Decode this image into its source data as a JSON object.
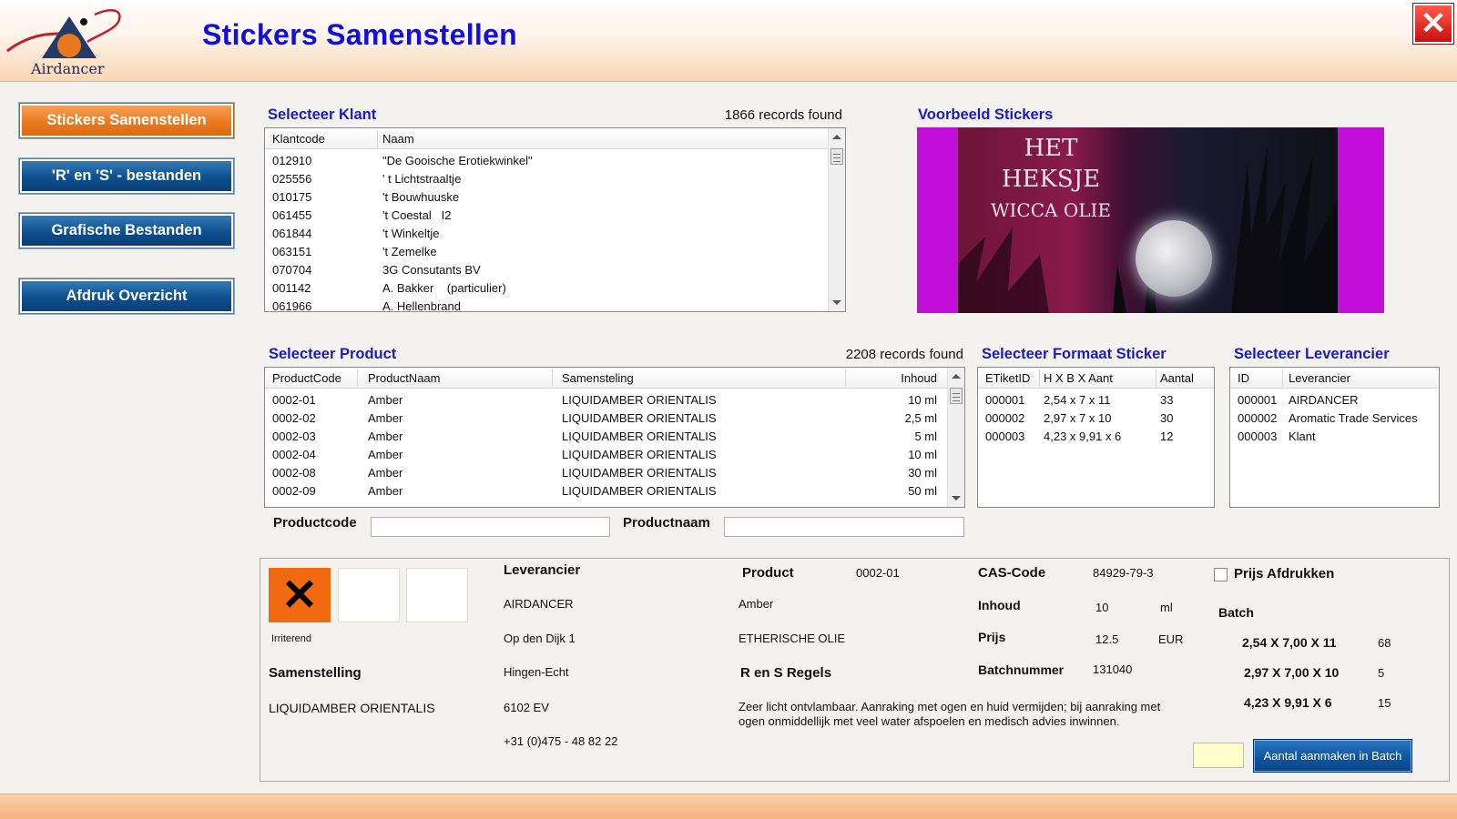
{
  "header": {
    "logo_text": "Airdancer",
    "title": "Stickers Samenstellen",
    "close_label": "✕"
  },
  "nav": {
    "items": [
      {
        "label": "Stickers Samenstellen",
        "active": true
      },
      {
        "label": "'R' en 'S' - bestanden",
        "active": false
      },
      {
        "label": "Grafische Bestanden",
        "active": false
      },
      {
        "label": "Afdruk Overzicht",
        "active": false
      }
    ]
  },
  "klant": {
    "title": "Selecteer Klant",
    "records": "1866 records found",
    "columns": [
      "Klantcode",
      "Naam"
    ],
    "rows": [
      [
        "012910",
        "\"De Gooische Erotiekwinkel\""
      ],
      [
        "025556",
        "' t Lichtstraaltje"
      ],
      [
        "010175",
        "'t Bouwhuuske"
      ],
      [
        "061455",
        "'t Coestal   I2"
      ],
      [
        "061844",
        "'t Winkeltje"
      ],
      [
        "063151",
        "'t Zemelke"
      ],
      [
        "070704",
        "3G Consutants BV"
      ],
      [
        "001142",
        "A. Bakker    (particulier)"
      ],
      [
        "061966",
        "A. Hellenbrand"
      ]
    ]
  },
  "preview": {
    "title": "Voorbeeld Stickers",
    "label_line1": "HET HEKSJE",
    "label_line2": "WICCA OLIE",
    "bg_color": "#c10ed8"
  },
  "product": {
    "title": "Selecteer Product",
    "records": "2208 records found",
    "columns": [
      "ProductCode",
      "ProductNaam",
      "Samensteling",
      "Inhoud"
    ],
    "rows": [
      [
        "0002-01",
        "Amber",
        "LIQUIDAMBER ORIENTALIS",
        "10 ml"
      ],
      [
        "0002-02",
        "Amber",
        "LIQUIDAMBER ORIENTALIS",
        "2,5 ml"
      ],
      [
        "0002-03",
        "Amber",
        "LIQUIDAMBER ORIENTALIS",
        "5 ml"
      ],
      [
        "0002-04",
        "Amber",
        "LIQUIDAMBER ORIENTALIS",
        "10 ml"
      ],
      [
        "0002-08",
        "Amber",
        "LIQUIDAMBER ORIENTALIS",
        "30 ml"
      ],
      [
        "0002-09",
        "Amber",
        "LIQUIDAMBER ORIENTALIS",
        "50 ml"
      ]
    ],
    "productcode_label": "Productcode",
    "productnaam_label": "Productnaam",
    "productcode_value": "",
    "productnaam_value": ""
  },
  "formaat": {
    "title": "Selecteer Formaat Sticker",
    "columns": [
      "ETiketID",
      "H X B X Aant",
      "Aantal"
    ],
    "rows": [
      [
        "000001",
        "2,54 x 7 x 11",
        "33"
      ],
      [
        "000002",
        "2,97 x 7 x 10",
        "30"
      ],
      [
        "000003",
        "4,23 x 9,91 x 6",
        "12"
      ]
    ]
  },
  "leverancier": {
    "title": "Selecteer Leverancier",
    "columns": [
      "ID",
      "Leverancier"
    ],
    "rows": [
      [
        "000001",
        "AIRDANCER"
      ],
      [
        "000002",
        "Aromatic Trade Services"
      ],
      [
        "000003",
        "Klant"
      ]
    ]
  },
  "detail": {
    "hazard_label": "Irriterend",
    "hazard_symbol": "✕",
    "samenstelling_label": "Samenstelling",
    "samenstelling_value": "LIQUIDAMBER ORIENTALIS",
    "leverancier_label": "Leverancier",
    "leverancier_name": "AIRDANCER",
    "leverancier_address": "Op den Dijk 1",
    "leverancier_city": "Hingen-Echt",
    "leverancier_zip": "6102 EV",
    "leverancier_phone": "+31 (0)475 - 48 82 22",
    "product_label": "Product",
    "product_code": "0002-01",
    "product_name": "Amber",
    "product_type": "ETHERISCHE OLIE",
    "rs_label": "R en S Regels",
    "rs_text_line1": "Zeer licht ontvlambaar. Aanraking met ogen en huid vermijden; bij aanraking met",
    "rs_text_line2": "ogen onmiddellijk met veel water afspoelen en medisch advies inwinnen.",
    "cas_label": "CAS-Code",
    "cas_value": "84929-79-3",
    "inhoud_label": "Inhoud",
    "inhoud_value": "10",
    "inhoud_unit": "ml",
    "prijs_label": "Prijs",
    "prijs_value": "12.5",
    "prijs_unit": "EUR",
    "batchnummer_label": "Batchnummer",
    "batchnummer_value": "131040",
    "prijs_afdrukken_label": "Prijs Afdrukken",
    "batch_label": "Batch",
    "batch_rows": [
      {
        "size": "2,54 X 7,00 X 11",
        "count": "68"
      },
      {
        "size": "2,97 X 7,00 X 10",
        "count": "5"
      },
      {
        "size": "4,23 X 9,91 X 6",
        "count": "15"
      }
    ],
    "batch_input_value": "",
    "batch_button_label": "Aantal aanmaken in Batch"
  }
}
